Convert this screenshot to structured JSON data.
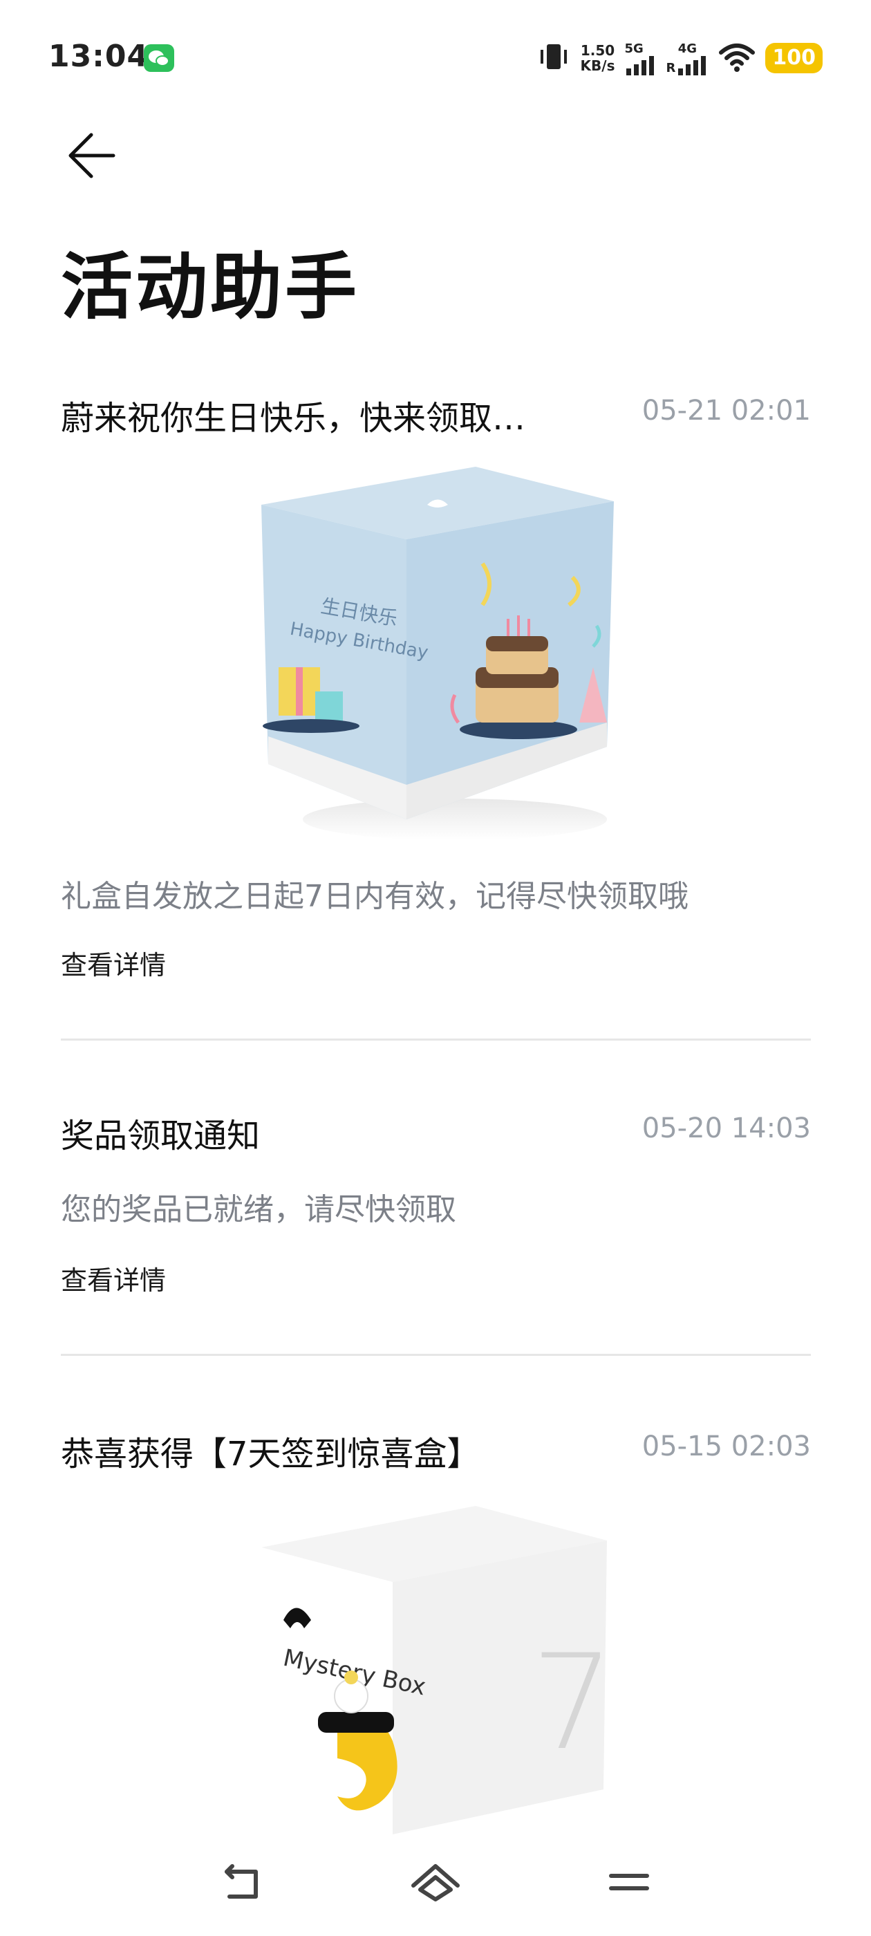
{
  "status_bar": {
    "time": "13:04",
    "speed_value": "1.50",
    "speed_unit": "KB/s",
    "net_5g": "5G",
    "net_4g": "4G",
    "net_r": "R",
    "battery": "100"
  },
  "page": {
    "title": "活动助手"
  },
  "messages": [
    {
      "title": "蔚来祝你生日快乐，快来领取…",
      "time": "05-21 02:01",
      "image_text_cn": "生日快乐",
      "image_text_en": "Happy Birthday",
      "desc": "礼盒自发放之日起7日内有效，记得尽快领取哦",
      "link": "查看详情"
    },
    {
      "title": "奖品领取通知",
      "time": "05-20 14:03",
      "desc": "您的奖品已就绪，请尽快领取",
      "link": "查看详情"
    },
    {
      "title": "恭喜获得【7天签到惊喜盒】",
      "time": "05-15 02:03",
      "image_text": "Mystery Box",
      "image_number": "7"
    }
  ],
  "icons": [
    "back-arrow-icon",
    "wechat-icon",
    "vibrate-icon",
    "signal-icon",
    "wifi-icon",
    "nav-back-icon",
    "nav-home-icon",
    "nav-menu-icon"
  ]
}
